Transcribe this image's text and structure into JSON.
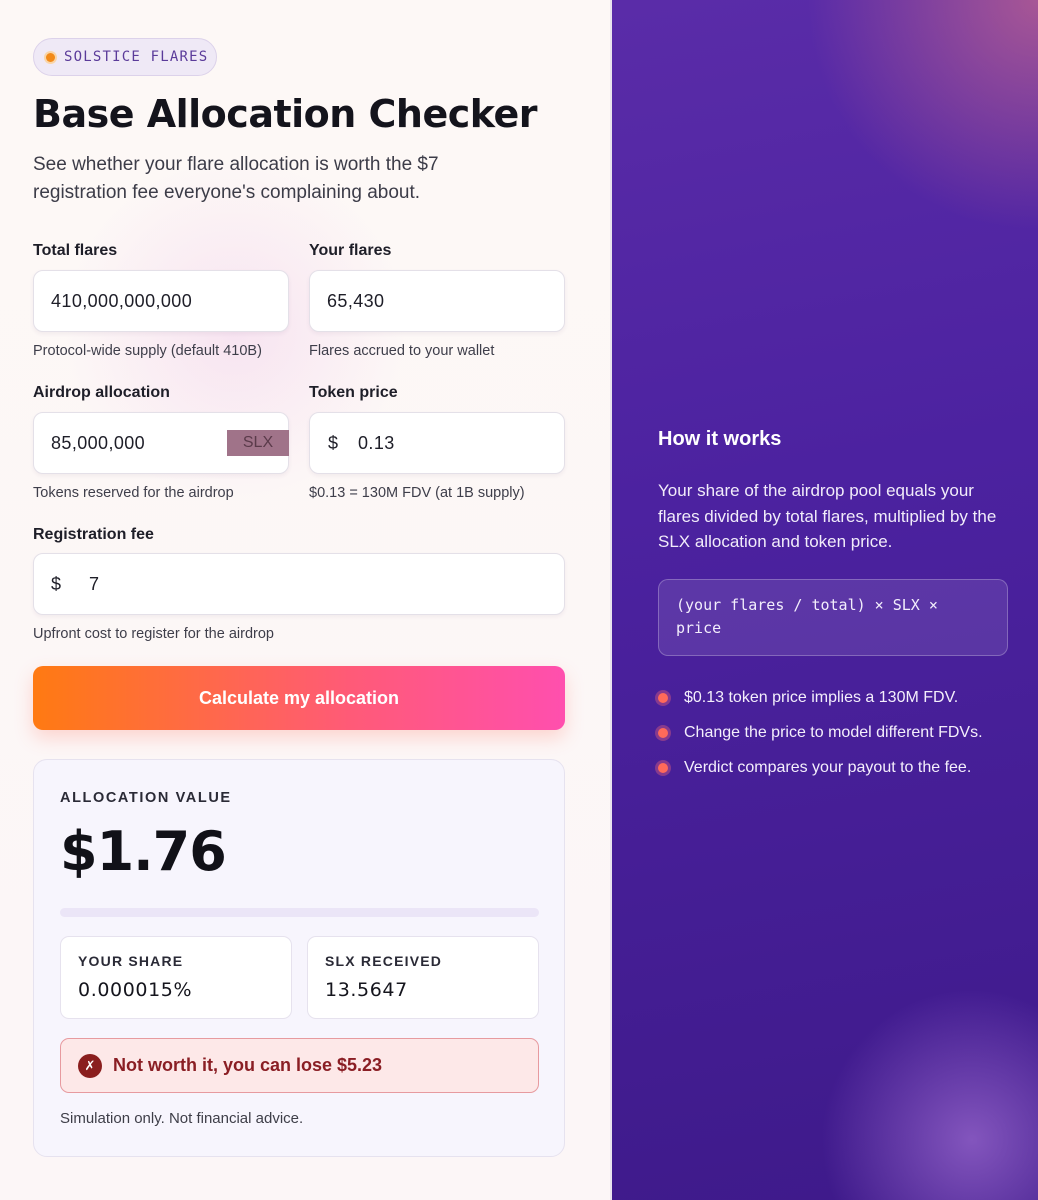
{
  "badge": {
    "label": "SOLSTICE FLARES",
    "icon": "dot-icon",
    "dot_color": "#f28a1a"
  },
  "header": {
    "title": "Base Allocation Checker",
    "subtitle": "See whether your flare allocation is worth the $7 registration fee everyone's complaining about."
  },
  "form": {
    "total_flares": {
      "label": "Total flares",
      "value": "410,000,000,000",
      "helper": "Protocol-wide supply (default 410B)"
    },
    "your_flares": {
      "label": "Your flares",
      "value": "65,430",
      "helper": "Flares accrued to your wallet"
    },
    "airdrop_allocation": {
      "label": "Airdrop allocation",
      "value": "85,000,000",
      "suffix": "SLX",
      "helper": "Tokens reserved for the airdrop"
    },
    "token_price": {
      "label": "Token price",
      "prefix": "$",
      "value": "0.13",
      "helper": "$0.13 = 130M FDV (at 1B supply)"
    },
    "registration_fee": {
      "label": "Registration fee",
      "prefix": "$",
      "value": "7",
      "helper": "Upfront cost to register for the airdrop"
    },
    "submit_label": "Calculate my allocation"
  },
  "result": {
    "heading": "ALLOCATION VALUE",
    "value": "$1.76",
    "progress_fraction": 0.0,
    "share": {
      "label": "YOUR SHARE",
      "value": "0.000015%"
    },
    "received": {
      "label": "SLX RECEIVED",
      "value": "13.5647"
    },
    "verdict": {
      "icon": "x-icon",
      "symbol": "✗",
      "text": "Not worth it, you can lose $5.23"
    },
    "disclaimer": "Simulation only. Not financial advice."
  },
  "how_it_works": {
    "title": "How it works",
    "description": "Your share of the airdrop pool equals your flares divided by total flares, multiplied by the SLX allocation and token price.",
    "formula": "(your flares / total) × SLX × price",
    "bullets": [
      "$0.13 token price implies a 130M FDV.",
      "Change the price to model different FDVs.",
      "Verdict compares your payout to the fee."
    ]
  },
  "colors": {
    "accent_orange": "#ff7a12",
    "accent_pink": "#ff4fae",
    "panel_purple": "#4c22a0",
    "verdict_red": "#8a1e24"
  }
}
